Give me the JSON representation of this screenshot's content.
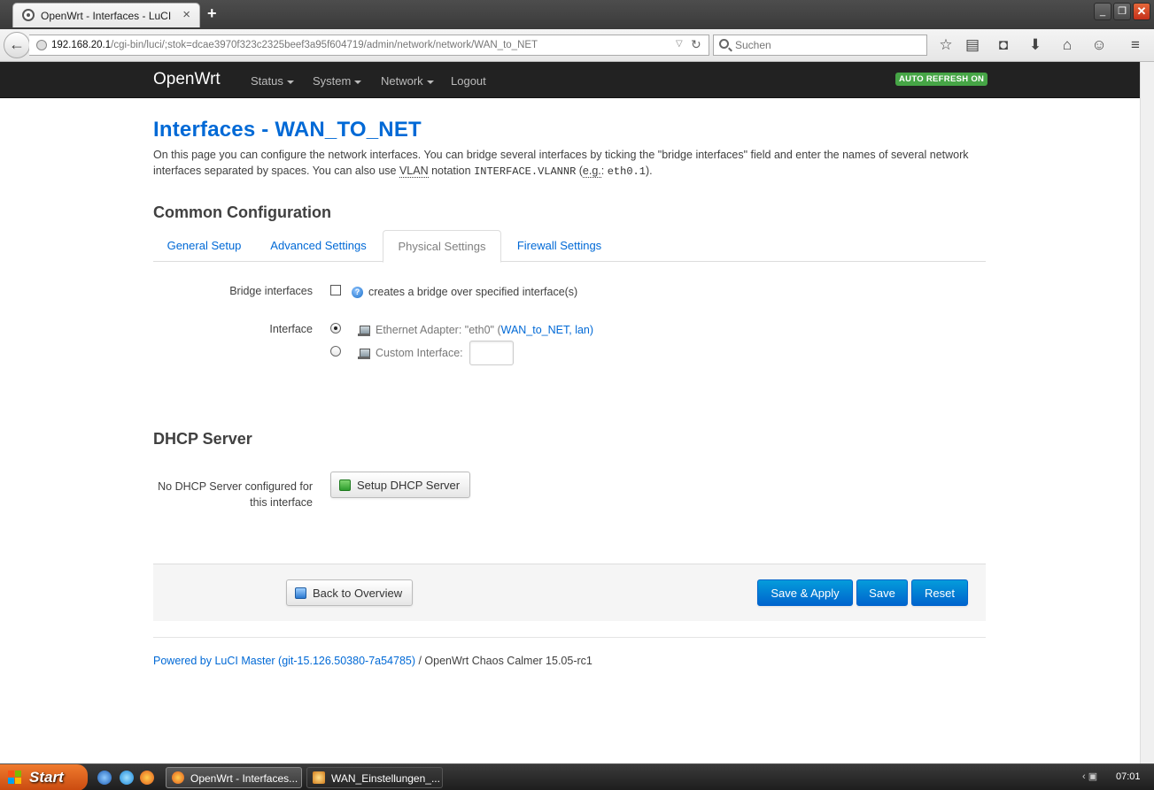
{
  "browser": {
    "tab_title": "OpenWrt - Interfaces - LuCI",
    "url_host": "192.168.20.1",
    "url_path": "/cgi-bin/luci/;stok=dcae3970f323c2325beef3a95f604719/admin/network/network/WAN_to_NET",
    "search_placeholder": "Suchen"
  },
  "luci": {
    "brand": "OpenWrt",
    "menu": [
      "Status",
      "System",
      "Network",
      "Logout"
    ],
    "auto_refresh": "AUTO REFRESH ON"
  },
  "page": {
    "title": "Interfaces - WAN_TO_NET",
    "desc_part1": "On this page you can configure the network interfaces. You can bridge several interfaces by ticking the \"bridge interfaces\" field and enter the names of several network interfaces separated by spaces. You can also use ",
    "desc_vlan": "VLAN",
    "desc_part2": " notation ",
    "desc_code1": "INTERFACE.VLANNR",
    "desc_part3": " (",
    "desc_eg": "e.g.",
    "desc_part4": ": ",
    "desc_code2": "eth0.1",
    "desc_part5": ").",
    "section_title": "Common Configuration",
    "tabs": [
      "General Setup",
      "Advanced Settings",
      "Physical Settings",
      "Firewall Settings"
    ],
    "active_tab": "Physical Settings",
    "bridge_label": "Bridge interfaces",
    "bridge_help": "creates a bridge over specified interface(s)",
    "interface_label": "Interface",
    "eth_adapter_text": "Ethernet Adapter: \"eth0\" (",
    "eth_adapter_links": "WAN_to_NET, lan",
    "eth_adapter_close": ")",
    "custom_interface_text": "Custom Interface:",
    "custom_interface_value": "",
    "dhcp_title": "DHCP Server",
    "dhcp_label_line1": "No DHCP Server configured for",
    "dhcp_label_line2": "this interface",
    "dhcp_button": "Setup DHCP Server",
    "back_button": "Back to Overview",
    "save_apply_button": "Save & Apply",
    "save_button": "Save",
    "reset_button": "Reset",
    "footer_link": "Powered by LuCI Master (git-15.126.50380-7a54785)",
    "footer_text": " / OpenWrt Chaos Calmer 15.05-rc1"
  },
  "taskbar": {
    "start": "Start",
    "tasks": [
      "OpenWrt - Interfaces...",
      "WAN_Einstellungen_..."
    ],
    "clock": "07:01"
  },
  "colors": {
    "accent": "#0069d6",
    "header_bg": "#222222",
    "auto_refresh": "#46a546",
    "primary_button": "#0064cd"
  }
}
